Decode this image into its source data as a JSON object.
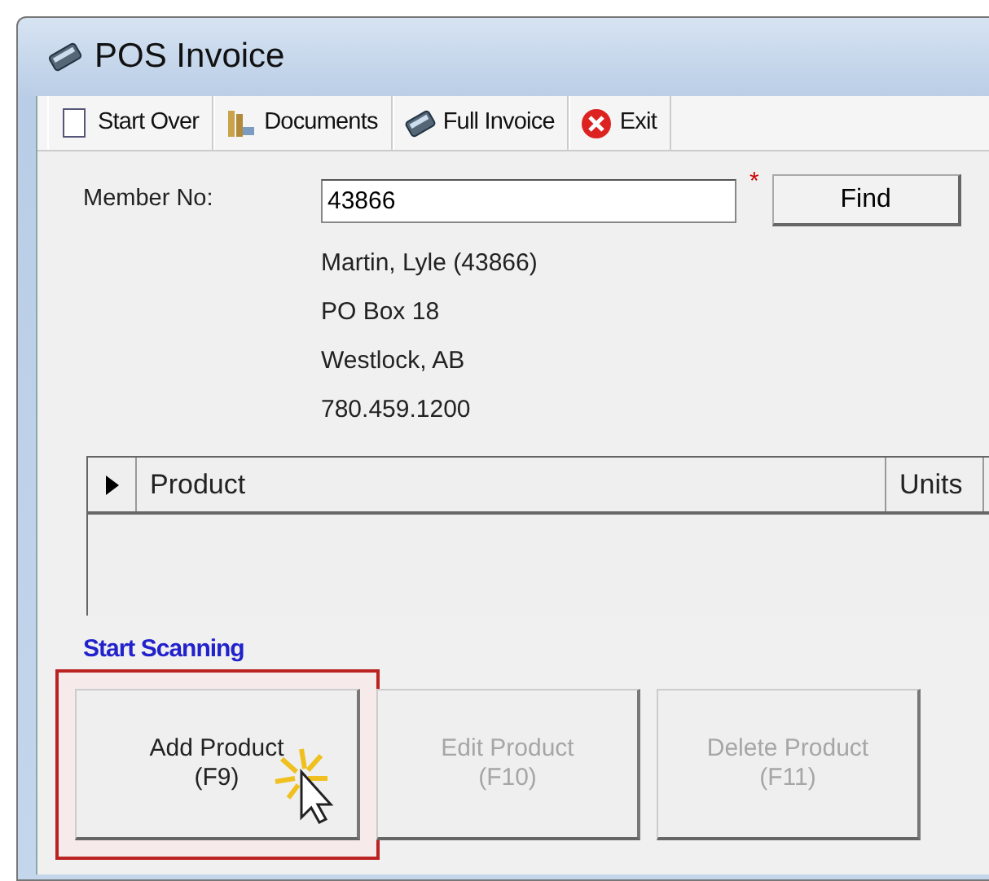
{
  "window": {
    "title": "POS Invoice"
  },
  "toolbar": [
    {
      "kind": "page",
      "label": "Start Over"
    },
    {
      "kind": "folder",
      "label": "Documents"
    },
    {
      "kind": "invoice",
      "label": "Full Invoice"
    },
    {
      "kind": "exit",
      "label": "Exit"
    }
  ],
  "member": {
    "label": "Member No:",
    "value": "43866",
    "required_mark": "*",
    "find_button": "Find"
  },
  "address_lines": [
    "Martin, Lyle (43866)",
    "PO Box 18",
    "Westlock, AB",
    "780.459.1200"
  ],
  "grid": {
    "columns": [
      "Product",
      "Units"
    ]
  },
  "section_label": "Start Scanning",
  "buttons": [
    {
      "label": "Add Product",
      "shortcut": "(F9)",
      "disabled": false,
      "highlighted": true
    },
    {
      "label": "Edit Product",
      "shortcut": "(F10)",
      "disabled": true,
      "highlighted": false
    },
    {
      "label": "Delete Product",
      "shortcut": "(F11)",
      "disabled": true,
      "highlighted": false
    }
  ]
}
